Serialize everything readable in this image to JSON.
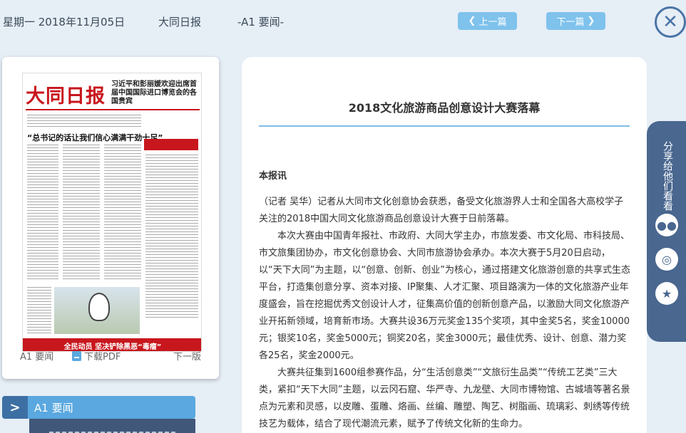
{
  "header": {
    "date": "星期一 2018年11月05日",
    "newspaper": "大同日报",
    "section": "-A1 要闻-",
    "prev_label": "上一篇",
    "next_label": "下一篇",
    "prev_icon": "chevron-left-icon",
    "next_icon": "chevron-right-icon",
    "close_icon": "close-icon"
  },
  "thumbnail": {
    "masthead": "大同日报",
    "headline": "习近平和彭丽媛欢迎出席首届中国国际进口博览会的各国贵宾",
    "big_headline": "“总书记的话让我们信心满满干劲十足”",
    "bottom_banner": "全民动员  坚决铲除黑恶“毒瘤”",
    "page_label": "A1 要闻",
    "pdf_label": "下载PDF",
    "next_page_label": "下一版"
  },
  "nav": {
    "active_label": "A1 要闻"
  },
  "article": {
    "title": "2018文化旅游商品创意设计大赛落幕",
    "lead": "本报讯",
    "p1": "（记者 吴华）记者从大同市文化创意协会获悉，备受文化旅游界人士和全国各大高校学子关注的2018中国大同文化旅游商品创意设计大赛于日前落幕。",
    "p2": "本次大赛由中国青年报社、市政府、大同大学主办，市旅发委、市文化局、市科技局、市文旅集团协办，市文化创意协会、大同市旅游协会承办。本次大赛于5月20日启动，以“天下大同”为主题，以“创意、创新、创业”为核心，通过搭建文化旅游创意的共享式生态平台，打造集创意分享、资本对接、IP聚集、人才汇聚、项目路演为一体的文化旅游产业年度盛会，旨在挖掘优秀文创设计人才，征集高价值的创新创意产品，以激励大同文化旅游产业开拓新领域，培育新市场。大赛共设36万元奖金135个奖项，其中金奖5名，奖金10000元；银奖10名，奖金5000元；铜奖20名，奖金3000元；最佳优秀、设计、创意、潜力奖各25名，奖金2000元。",
    "p3": "大赛共征集到1600组参赛作品，分“生活创意类”“文旅衍生品类”“传统工艺类”三大类，紧扣“天下大同”主题，以云冈石窟、华严寺、九龙壁、大同市博物馆、古城墙等著名景点为元素和灵感，以皮雕、蛋雕、烙画、丝编、雕塑、陶艺、树脂画、琉璃彩、刺绣等传统技艺为载体，结合了现代潮流元素，赋予了传统文化新的生命力。"
  },
  "share": {
    "label": "分享给他们看看",
    "icons": [
      "wechat-icon",
      "weibo-icon",
      "favorite-star-icon"
    ]
  }
}
